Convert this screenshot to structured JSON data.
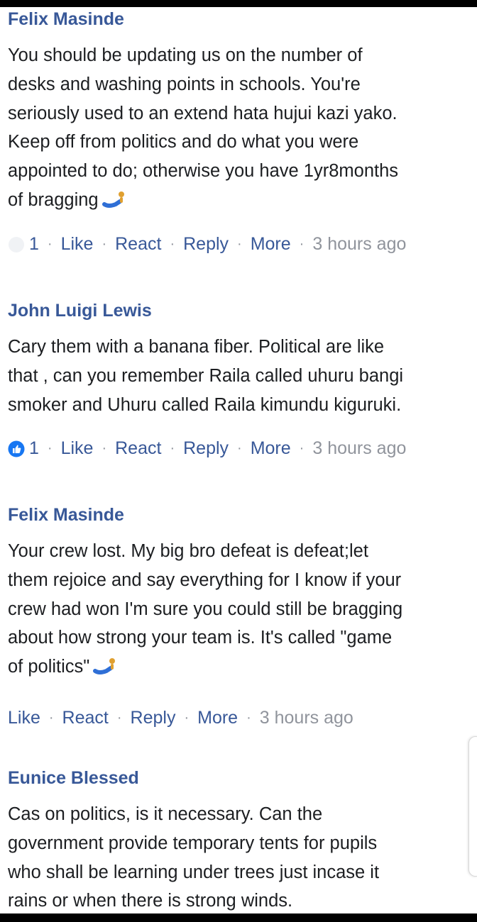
{
  "comments": [
    {
      "author": "Felix Masinde",
      "lines": [
        "You should be updating us on the number of",
        "desks and washing points in schools. You're",
        "seriously used to an extend hata hujui kazi yako.",
        "Keep off from politics and do what you were",
        "appointed to do; otherwise you have 1yr8months",
        "of bragging"
      ],
      "emoji": "person-lying-icon",
      "reaction": {
        "icon": "reaction-faded-icon",
        "count": "1"
      },
      "actions": {
        "like": "Like",
        "react": "React",
        "reply": "Reply",
        "more": "More",
        "time": "3 hours ago"
      }
    },
    {
      "author": "John Luigi Lewis",
      "lines": [
        "Cary them with a banana fiber.  Political are like",
        "that , can you remember Raila called uhuru bangi",
        "smoker and Uhuru called Raila kimundu kiguruki."
      ],
      "reaction": {
        "icon": "like-reaction-icon",
        "count": "1"
      },
      "actions": {
        "like": "Like",
        "react": "React",
        "reply": "Reply",
        "more": "More",
        "time": "3 hours ago"
      }
    },
    {
      "author": "Felix Masinde",
      "lines": [
        "Your crew lost. My big bro defeat is defeat;let",
        "them rejoice and say everything for I know if your",
        "crew had won I'm sure you could still be bragging",
        "about how strong your team is. It's called \"game",
        "of politics\""
      ],
      "emoji": "person-lying-icon",
      "actions": {
        "like": "Like",
        "react": "React",
        "reply": "Reply",
        "more": "More",
        "time": "3 hours ago"
      }
    },
    {
      "author": "Eunice Blessed",
      "lines": [
        "Cas on politics, is it necessary.  Can the",
        "government provide temporary tents for pupils",
        "who shall be learning under trees just incase it",
        "rains or when there is strong winds."
      ]
    }
  ],
  "colors": {
    "link": "#385898",
    "meta": "#90949c",
    "text": "#1c1e21",
    "like_blue": "#1877f2"
  }
}
